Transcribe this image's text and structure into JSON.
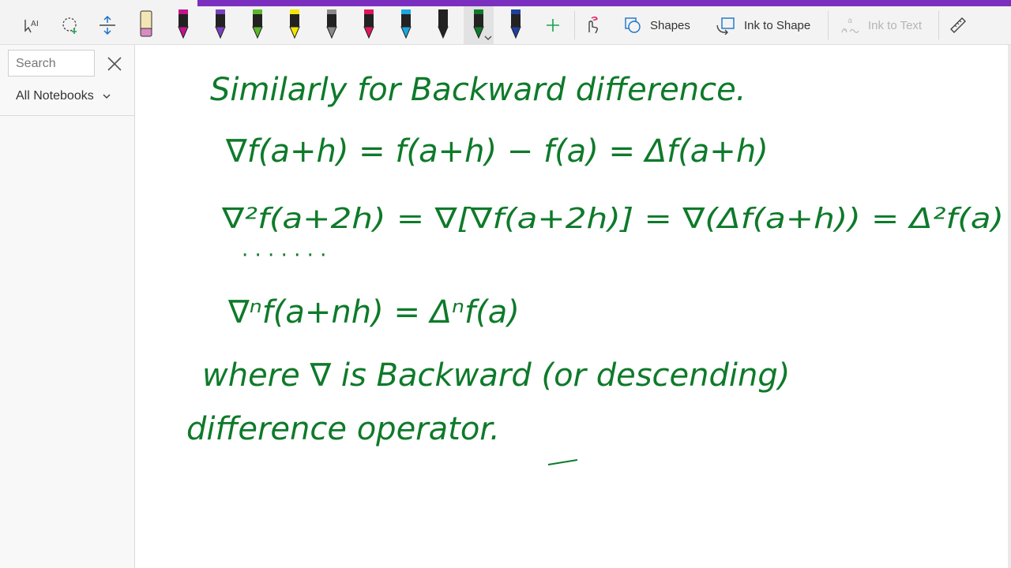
{
  "ribbon": {
    "shapes_label": "Shapes",
    "ink_to_shape_label": "Ink to Shape",
    "ink_to_text_label": "Ink to Text",
    "pen_colors": [
      "#f3e6b5",
      "#c2148f",
      "#7b3fc1",
      "#5cb82a",
      "#f2e600",
      "#8a8a8a",
      "#e0155e",
      "#1aa7e0",
      "#222222",
      "#0e7a2a",
      "#1f3f9f"
    ]
  },
  "sidebar": {
    "search_placeholder": "Search",
    "notebooks_label": "All Notebooks"
  },
  "page": {
    "ink_color": "#0e7a2a",
    "lines": [
      "Similarly for Backward difference.",
      "∇f(a+h) = f(a+h) − f(a) = Δf(a+h)",
      "∇²f(a+2h) = ∇[∇f(a+2h)] = ∇(Δf(a+h)) = Δ²f(a)",
      "· · · · · · ·",
      "∇ⁿf(a+nh) = Δⁿf(a)",
      "where ∇ is Backward (or descending)",
      "difference operator."
    ]
  }
}
